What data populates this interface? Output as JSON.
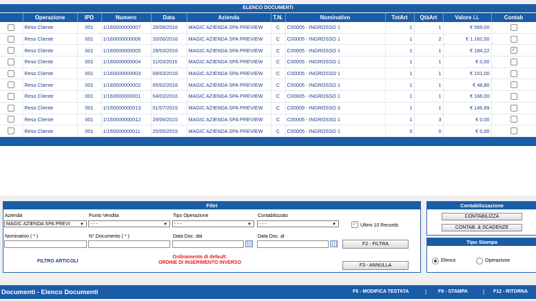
{
  "list": {
    "title": "ELENCO DOCUMENTI",
    "columns": [
      "",
      "Operazione",
      "IPD",
      "Numero",
      "Data",
      "Azienda",
      "T.N.",
      "Nominativo",
      "TotArt",
      "QtàArt",
      "Valore i.i.",
      "Contab"
    ],
    "rows": [
      {
        "checked": false,
        "operazione": "Reso Cliente",
        "ipd": "001",
        "numero": "1/160000000007",
        "data": "29/08/2016",
        "azienda": "MAGIC AZIENDA SPA PREVIEW",
        "tn": "C",
        "nominativo": "C00005 - INGROSSO 1",
        "totart": "1",
        "qtaart": "1",
        "valore": "€ 569,00",
        "contab": false
      },
      {
        "checked": false,
        "operazione": "Reso Cliente",
        "ipd": "001",
        "numero": "1/160000000006",
        "data": "20/06/2016",
        "azienda": "MAGIC AZIENDA SPA PREVIEW",
        "tn": "C",
        "nominativo": "C00005 - INGROSSO 1",
        "totart": "1",
        "qtaart": "2",
        "valore": "€ 1.162,00",
        "contab": false
      },
      {
        "checked": false,
        "operazione": "Reso Cliente",
        "ipd": "001",
        "numero": "1/160000000005",
        "data": "29/03/2016",
        "azienda": "MAGIC AZIENDA SPA PREVIEW",
        "tn": "C",
        "nominativo": "C00005 - INGROSSO 1",
        "totart": "1",
        "qtaart": "1",
        "valore": "€ 184,22",
        "contab": true
      },
      {
        "checked": false,
        "operazione": "Reso Cliente",
        "ipd": "001",
        "numero": "1/160000000004",
        "data": "11/03/2016",
        "azienda": "MAGIC AZIENDA SPA PREVIEW",
        "tn": "C",
        "nominativo": "C00005 - INGROSSO 1",
        "totart": "1",
        "qtaart": "1",
        "valore": "€ 0,00",
        "contab": false
      },
      {
        "checked": false,
        "operazione": "Reso Cliente",
        "ipd": "001",
        "numero": "1/160000000003",
        "data": "09/03/2016",
        "azienda": "MAGIC AZIENDA SPA PREVIEW",
        "tn": "C",
        "nominativo": "C00005 - INGROSSO 1",
        "totart": "1",
        "qtaart": "1",
        "valore": "€ 151,00",
        "contab": false
      },
      {
        "checked": false,
        "operazione": "Reso Cliente",
        "ipd": "001",
        "numero": "1/160000000002",
        "data": "05/02/2016",
        "azienda": "MAGIC AZIENDA SPA PREVIEW",
        "tn": "C",
        "nominativo": "C00005 - INGROSSO 1",
        "totart": "1",
        "qtaart": "1",
        "valore": "€ 48,80",
        "contab": false
      },
      {
        "checked": false,
        "operazione": "Reso Cliente",
        "ipd": "001",
        "numero": "1/160000000001",
        "data": "04/02/2016",
        "azienda": "MAGIC AZIENDA SPA PREVIEW",
        "tn": "C",
        "nominativo": "C00005 - INGROSSO 1",
        "totart": "1",
        "qtaart": "1",
        "valore": "€ 166,00",
        "contab": false
      },
      {
        "checked": false,
        "operazione": "Reso Cliente",
        "ipd": "001",
        "numero": "1/150000000013",
        "data": "01/07/2015",
        "azienda": "MAGIC AZIENDA SPA PREVIEW",
        "tn": "C",
        "nominativo": "C00009 - INGROSSO 3",
        "totart": "1",
        "qtaart": "1",
        "valore": "€ 146,89",
        "contab": false
      },
      {
        "checked": false,
        "operazione": "Reso Cliente",
        "ipd": "001",
        "numero": "1/150000000012",
        "data": "29/06/2015",
        "azienda": "MAGIC AZIENDA SPA PREVIEW",
        "tn": "C",
        "nominativo": "C00005 - INGROSSO 1",
        "totart": "1",
        "qtaart": "3",
        "valore": "€ 0,00",
        "contab": false
      },
      {
        "checked": false,
        "operazione": "Reso Cliente",
        "ipd": "001",
        "numero": "1/150000000011",
        "data": "25/05/2015",
        "azienda": "MAGIC AZIENDA SPA PREVIEW",
        "tn": "C",
        "nominativo": "C00005 - INGROSSO 1",
        "totart": "0",
        "qtaart": "0",
        "valore": "€ 0,00",
        "contab": false
      }
    ]
  },
  "filters": {
    "title": "Filtri",
    "azienda_label": "Azienda",
    "azienda_value": "MAGIC AZIENDA SPA PREVI",
    "punto_vendita_label": "Punto Vendita",
    "punto_vendita_value": "- - -",
    "tipo_operazione_label": "Tipo Operazione",
    "tipo_operazione_value": "- - -",
    "contabilizzato_label": "Contabilizzato",
    "contabilizzato_value": "- - -",
    "ultimi_label": "Ultimi 10 Records",
    "ultimi_checked": true,
    "nominativo_label": "Nominativo ( * )",
    "documento_label": "N° Documento ( * )",
    "data_dal_label": "Data Doc. dal",
    "data_al_label": "Data Doc. al",
    "filtra_button": "F2 - FILTRA",
    "annulla_button": "F3 - ANNULLA",
    "filtro_articoli": "FILTRO ARTICOLI",
    "ordinamento_line1": "Ordinamento di default:",
    "ordinamento_line2": "ORDINE DI INSERIMENTO INVERSO"
  },
  "contabilizzazione": {
    "title": "Contabilizzazione",
    "contabilizza_button": "CONTABILIZZA",
    "scadenze_button": "CONTAB. & SCADENZE"
  },
  "tipo_stampa": {
    "title": "Tipo Stampa",
    "elenco_label": "Elenco",
    "operazione_label": "Operazione",
    "selected": "Elenco"
  },
  "status": {
    "page_title": "Documenti - Elenco Documenti",
    "f6": "F6 - MODIFICA TESTATA",
    "f9": "F9 - STAMPA",
    "f12": "F12 - RITORNA",
    "separator": "|"
  },
  "colors": {
    "primary": "#1a5ca8",
    "text_link": "#1e3c8c",
    "warning": "#e02020"
  }
}
